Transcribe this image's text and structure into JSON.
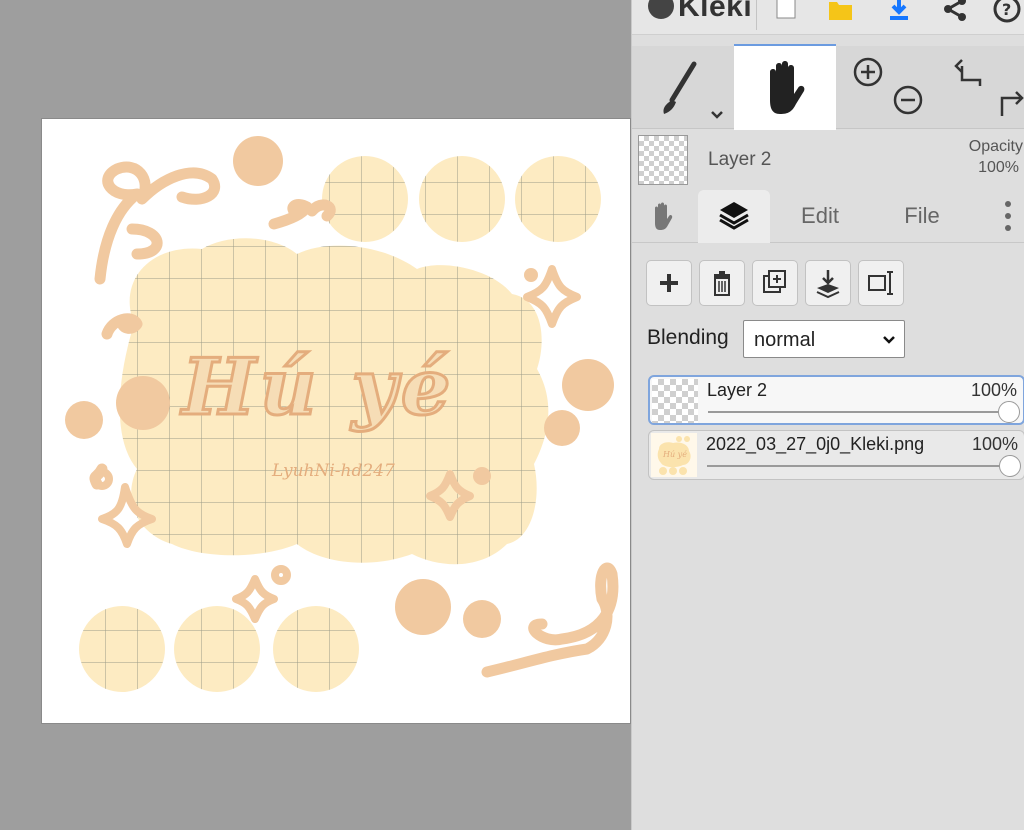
{
  "app": {
    "name": "Kleki"
  },
  "topbar": {
    "icons": [
      "new-image-icon",
      "open-folder-icon",
      "download-icon",
      "share-icon",
      "help-icon"
    ]
  },
  "tools": {
    "brush": "brush-icon",
    "hand": "hand-icon",
    "zoom": [
      "zoom-in-icon",
      "zoom-out-icon"
    ],
    "history": [
      "undo-icon",
      "redo-icon"
    ]
  },
  "current_layer": {
    "name": "Layer 2",
    "opacity_label": "Opacity",
    "opacity_value": "100%"
  },
  "tabs": {
    "edit": "Edit",
    "file": "File"
  },
  "layer_actions": [
    "add-layer-icon",
    "delete-layer-icon",
    "duplicate-layer-icon",
    "merge-down-icon",
    "rename-layer-icon"
  ],
  "blending": {
    "label": "Blending",
    "value": "normal"
  },
  "layers": [
    {
      "name": "Layer 2",
      "opacity": "100%",
      "opacity_fraction": 1.0,
      "selected": true
    },
    {
      "name": "2022_03_27_0j0_Kleki.png",
      "opacity": "100%",
      "opacity_fraction": 1.0,
      "selected": false
    }
  ],
  "artwork": {
    "title_text": "Hú yé",
    "signature_text": "LyuhNi-hd247",
    "colors": {
      "cream": "#fdebc2",
      "peach": "#f1c9a0",
      "peach_dark": "#e4ad7d",
      "grid": "#7b8074"
    }
  }
}
